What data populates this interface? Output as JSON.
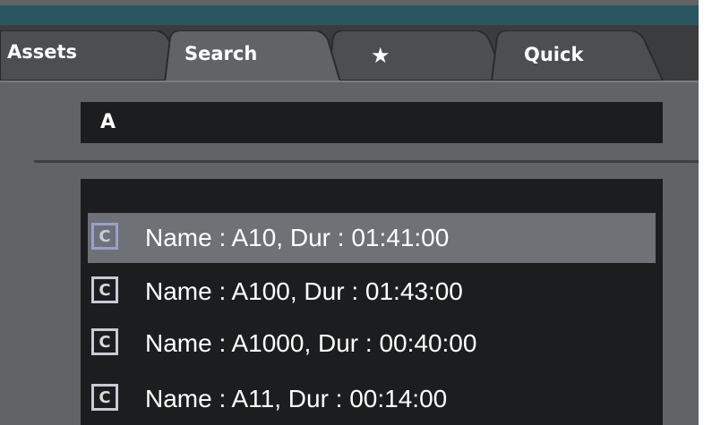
{
  "tabs": [
    {
      "label": "Assets",
      "active": false
    },
    {
      "label": "Search",
      "active": true
    },
    {
      "label": "★",
      "active": false
    },
    {
      "label": "Quick",
      "active": false
    }
  ],
  "search": {
    "value": "A"
  },
  "results": [
    {
      "badge": "C",
      "text": "Name : A10, Dur : 01:41:00",
      "selected": true
    },
    {
      "badge": "C",
      "text": "Name : A100, Dur : 01:43:00",
      "selected": false
    },
    {
      "badge": "C",
      "text": "Name : A1000, Dur : 00:40:00",
      "selected": false
    },
    {
      "badge": "C",
      "text": "Name : A11, Dur : 00:14:00",
      "selected": false
    }
  ]
}
